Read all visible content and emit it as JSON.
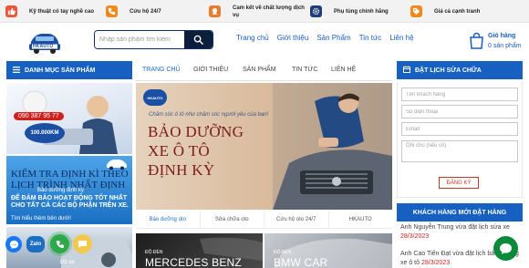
{
  "topbar": {
    "items": [
      {
        "text": "Kỹ thuật có tay nghề cao",
        "icon": "thumbs-up-icon",
        "color": "#e8573a"
      },
      {
        "text": "Cứu hộ 24/7",
        "icon": "phone-24-icon",
        "color": "#f08a1c"
      },
      {
        "text": "Cam kết về chất lượng dịch vụ",
        "icon": "badge-icon",
        "color": "#e87b2c"
      },
      {
        "text": "Phụ tùng chính hãng",
        "icon": "gear-icon",
        "color": "#1f3d7a"
      },
      {
        "text": "Giá cả cạnh tranh",
        "icon": "price-tag-icon",
        "color": "#f08a1c"
      }
    ]
  },
  "header": {
    "logo_text": "HKAUTO",
    "search_placeholder": "Nhập sản phẩm tìm kiếm",
    "nav": [
      "Trang chủ",
      "Giới thiệu",
      "Sản Phẩm",
      "Tin tức",
      "Liên hệ"
    ],
    "cart": {
      "title": "Giỏ hàng",
      "count": "0 sản phẩm"
    }
  },
  "sidebar": {
    "heading": "DANH MỤC SẢN PHẨM",
    "banner1": {
      "phone": "090 387 95 77",
      "badge": "100.000KM"
    },
    "banner2": {
      "title": "KIỂM TRA ĐỊNH KÌ THEO LỊCH TRÌNH NHẤT ĐỊNH",
      "subtitle": "Bảo dưỡng định kỳ",
      "desc": "ĐỂ ĐẢM BẢO HOẠT ĐỘNG TỐT NHẤT CHO TẤT CẢ CÁC BỘ PHẬN TRÊN XE.",
      "link": "Tìm hiểu thêm bên dưới!"
    },
    "banner3": {
      "label": "Đồ xe"
    }
  },
  "center": {
    "subnav": [
      "TRANG CHỦ",
      "GIỚI THIỆU",
      "SẢN PHẨM",
      "TIN TỨC",
      "LIÊN HỆ"
    ],
    "hero": {
      "logo_text": "HKAUTO",
      "tagline": "Chăm sóc ô tô như chăm sóc người yêu của bạn!",
      "title_lines": [
        "BẢO DƯỠNG",
        "XE Ô TÔ",
        "ĐỊNH KỲ"
      ]
    },
    "tabs": [
      "Bảo dưỡng oto",
      "Sửa chữa oto",
      "Cứu hộ oto 24/7",
      "HKAUTO"
    ],
    "cards": [
      {
        "small": "ĐỘ ĐÈN",
        "big": "MERCEDES BENZ"
      },
      {
        "small": "ĐỘ ĐÈN",
        "big": "BMW CAR"
      }
    ]
  },
  "booking": {
    "heading": "ĐẶT LỊCH SỬA CHỮA",
    "name_placeholder": "Tên khách hàng",
    "phone_placeholder": "Số điện thoại",
    "email_placeholder": "Email",
    "note_placeholder": "Ghi chú (nếu có)",
    "submit": "ĐĂNG KÝ"
  },
  "orders": {
    "heading": "KHÁCH HÀNG MỚI ĐẶT HÀNG",
    "items": [
      {
        "text": "Anh Nguyễn Trung vừa đặt lịch sửa xe",
        "date": "28/3/2023"
      },
      {
        "text": "Anh Cao Tiến Đạt vừa đặt lịch bảo dưỡng xe ô tô",
        "date": "28/3/2023"
      }
    ]
  },
  "floating": {
    "zalo": "Zalo"
  },
  "colors": {
    "primary_blue": "#1560c0",
    "navy": "#0b1f3a",
    "accent_red": "#d0211c",
    "messenger": "#1877f2",
    "phone_green": "#2ea94a",
    "chat_green": "#0a8a3a"
  }
}
